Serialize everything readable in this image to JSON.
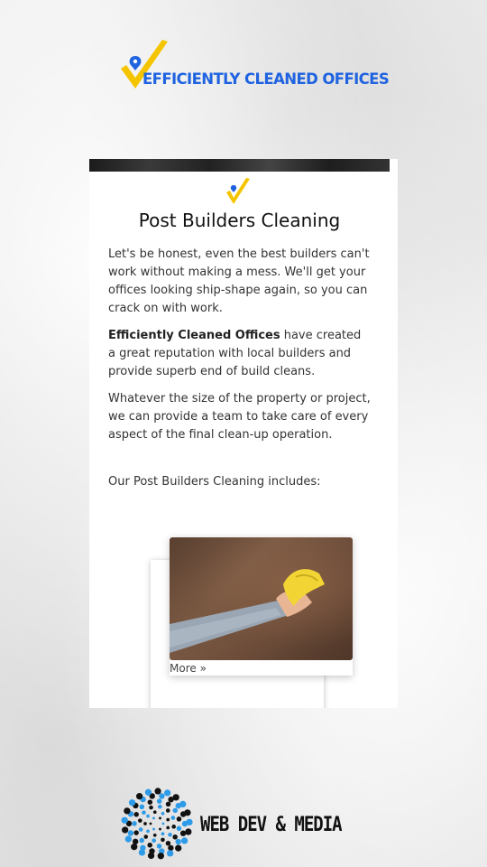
{
  "header": {
    "brand_text": "EFFICIENTLY CLEANED OFFICES"
  },
  "card": {
    "title": "Post Builders Cleaning",
    "paragraph_1": "Let's be honest, even the best builders can't work without making a mess. We'll get your offices looking ship-shape again, so you can crack on with work.",
    "paragraph_2_bold": "Efficiently Cleaned Offices",
    "paragraph_2_rest": " have created a great reputation with local builders and provide superb end of build cleans.",
    "paragraph_3": "Whatever the size of the property or project, we can provide a team to take care of every aspect of the final clean-up operation.",
    "paragraph_4": "Our Post Builders Cleaning includes:",
    "more_label": "More »"
  },
  "footer": {
    "brand_text": "WEB DEV & MEDIA"
  },
  "colors": {
    "check_yellow": "#f5c400",
    "pin_blue": "#1f63e0",
    "brand_blue": "#1f63e0"
  },
  "icons": {
    "logo_mark": "check-pin-icon",
    "footer_mark": "dot-spiral-icon"
  }
}
